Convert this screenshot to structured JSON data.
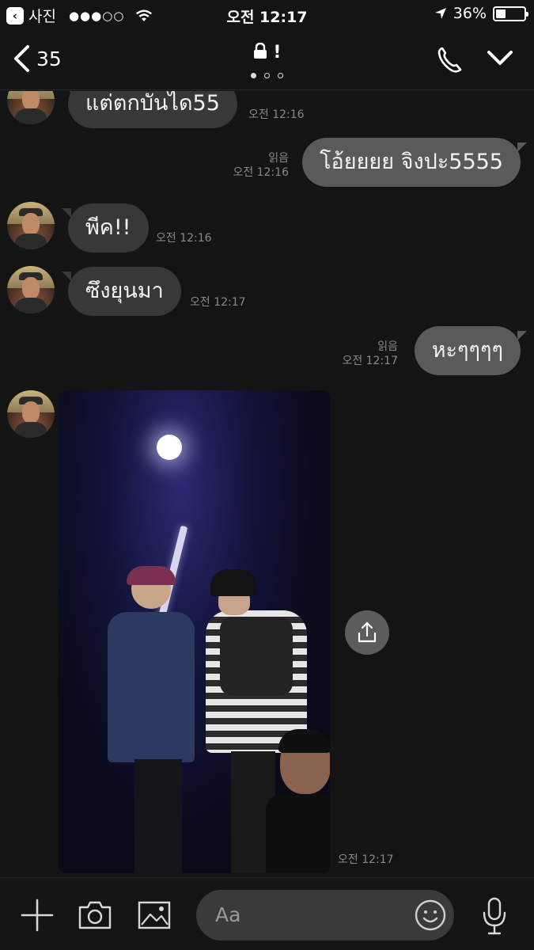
{
  "status_bar": {
    "back_app": "사진",
    "signal": "●●●○○",
    "time": "오전 12:17",
    "battery": "36%",
    "battery_level": 0.36
  },
  "nav": {
    "back_count": "35",
    "title_suffix": "!",
    "page_indicator": {
      "count": 3,
      "active": 0
    }
  },
  "messages": [
    {
      "direction": "in",
      "text": "แต่ตกบันได55",
      "time": "오전 12:16"
    },
    {
      "direction": "out",
      "text": "โอ้ยยยย จิงปะ5555",
      "read": "읽음",
      "time": "오전 12:16"
    },
    {
      "direction": "in",
      "text": "พีค!!",
      "time": "오전 12:16"
    },
    {
      "direction": "in",
      "text": "ซึงยุนมา",
      "time": "오전 12:17"
    },
    {
      "direction": "out",
      "text": "หะๆๆๆๆ",
      "read": "읽음",
      "time": "오전 12:17"
    },
    {
      "direction": "in",
      "type": "photo",
      "time": "오전 12:17"
    }
  ],
  "input": {
    "placeholder": "Aa"
  },
  "icons": {
    "nav": [
      "chevron-left-icon",
      "lock-icon",
      "phone-icon",
      "chevron-down-icon"
    ],
    "bottom": [
      "plus-icon",
      "camera-icon",
      "image-icon",
      "emoji-icon",
      "microphone-icon"
    ],
    "share": "share-icon"
  },
  "colors": {
    "background": "#141414",
    "bubble_in": "#383838",
    "bubble_out": "#5a5a5a",
    "meta_text": "#888888"
  }
}
